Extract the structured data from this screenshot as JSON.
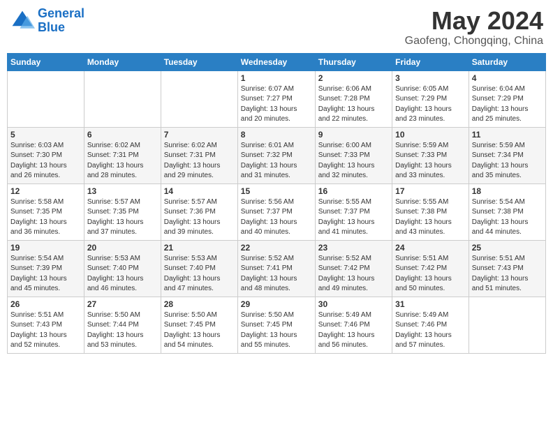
{
  "header": {
    "logo_line1": "General",
    "logo_line2": "Blue",
    "month_year": "May 2024",
    "location": "Gaofeng, Chongqing, China"
  },
  "days_of_week": [
    "Sunday",
    "Monday",
    "Tuesday",
    "Wednesday",
    "Thursday",
    "Friday",
    "Saturday"
  ],
  "weeks": [
    [
      {
        "day": "",
        "info": ""
      },
      {
        "day": "",
        "info": ""
      },
      {
        "day": "",
        "info": ""
      },
      {
        "day": "1",
        "info": "Sunrise: 6:07 AM\nSunset: 7:27 PM\nDaylight: 13 hours\nand 20 minutes."
      },
      {
        "day": "2",
        "info": "Sunrise: 6:06 AM\nSunset: 7:28 PM\nDaylight: 13 hours\nand 22 minutes."
      },
      {
        "day": "3",
        "info": "Sunrise: 6:05 AM\nSunset: 7:29 PM\nDaylight: 13 hours\nand 23 minutes."
      },
      {
        "day": "4",
        "info": "Sunrise: 6:04 AM\nSunset: 7:29 PM\nDaylight: 13 hours\nand 25 minutes."
      }
    ],
    [
      {
        "day": "5",
        "info": "Sunrise: 6:03 AM\nSunset: 7:30 PM\nDaylight: 13 hours\nand 26 minutes."
      },
      {
        "day": "6",
        "info": "Sunrise: 6:02 AM\nSunset: 7:31 PM\nDaylight: 13 hours\nand 28 minutes."
      },
      {
        "day": "7",
        "info": "Sunrise: 6:02 AM\nSunset: 7:31 PM\nDaylight: 13 hours\nand 29 minutes."
      },
      {
        "day": "8",
        "info": "Sunrise: 6:01 AM\nSunset: 7:32 PM\nDaylight: 13 hours\nand 31 minutes."
      },
      {
        "day": "9",
        "info": "Sunrise: 6:00 AM\nSunset: 7:33 PM\nDaylight: 13 hours\nand 32 minutes."
      },
      {
        "day": "10",
        "info": "Sunrise: 5:59 AM\nSunset: 7:33 PM\nDaylight: 13 hours\nand 33 minutes."
      },
      {
        "day": "11",
        "info": "Sunrise: 5:59 AM\nSunset: 7:34 PM\nDaylight: 13 hours\nand 35 minutes."
      }
    ],
    [
      {
        "day": "12",
        "info": "Sunrise: 5:58 AM\nSunset: 7:35 PM\nDaylight: 13 hours\nand 36 minutes."
      },
      {
        "day": "13",
        "info": "Sunrise: 5:57 AM\nSunset: 7:35 PM\nDaylight: 13 hours\nand 37 minutes."
      },
      {
        "day": "14",
        "info": "Sunrise: 5:57 AM\nSunset: 7:36 PM\nDaylight: 13 hours\nand 39 minutes."
      },
      {
        "day": "15",
        "info": "Sunrise: 5:56 AM\nSunset: 7:37 PM\nDaylight: 13 hours\nand 40 minutes."
      },
      {
        "day": "16",
        "info": "Sunrise: 5:55 AM\nSunset: 7:37 PM\nDaylight: 13 hours\nand 41 minutes."
      },
      {
        "day": "17",
        "info": "Sunrise: 5:55 AM\nSunset: 7:38 PM\nDaylight: 13 hours\nand 43 minutes."
      },
      {
        "day": "18",
        "info": "Sunrise: 5:54 AM\nSunset: 7:38 PM\nDaylight: 13 hours\nand 44 minutes."
      }
    ],
    [
      {
        "day": "19",
        "info": "Sunrise: 5:54 AM\nSunset: 7:39 PM\nDaylight: 13 hours\nand 45 minutes."
      },
      {
        "day": "20",
        "info": "Sunrise: 5:53 AM\nSunset: 7:40 PM\nDaylight: 13 hours\nand 46 minutes."
      },
      {
        "day": "21",
        "info": "Sunrise: 5:53 AM\nSunset: 7:40 PM\nDaylight: 13 hours\nand 47 minutes."
      },
      {
        "day": "22",
        "info": "Sunrise: 5:52 AM\nSunset: 7:41 PM\nDaylight: 13 hours\nand 48 minutes."
      },
      {
        "day": "23",
        "info": "Sunrise: 5:52 AM\nSunset: 7:42 PM\nDaylight: 13 hours\nand 49 minutes."
      },
      {
        "day": "24",
        "info": "Sunrise: 5:51 AM\nSunset: 7:42 PM\nDaylight: 13 hours\nand 50 minutes."
      },
      {
        "day": "25",
        "info": "Sunrise: 5:51 AM\nSunset: 7:43 PM\nDaylight: 13 hours\nand 51 minutes."
      }
    ],
    [
      {
        "day": "26",
        "info": "Sunrise: 5:51 AM\nSunset: 7:43 PM\nDaylight: 13 hours\nand 52 minutes."
      },
      {
        "day": "27",
        "info": "Sunrise: 5:50 AM\nSunset: 7:44 PM\nDaylight: 13 hours\nand 53 minutes."
      },
      {
        "day": "28",
        "info": "Sunrise: 5:50 AM\nSunset: 7:45 PM\nDaylight: 13 hours\nand 54 minutes."
      },
      {
        "day": "29",
        "info": "Sunrise: 5:50 AM\nSunset: 7:45 PM\nDaylight: 13 hours\nand 55 minutes."
      },
      {
        "day": "30",
        "info": "Sunrise: 5:49 AM\nSunset: 7:46 PM\nDaylight: 13 hours\nand 56 minutes."
      },
      {
        "day": "31",
        "info": "Sunrise: 5:49 AM\nSunset: 7:46 PM\nDaylight: 13 hours\nand 57 minutes."
      },
      {
        "day": "",
        "info": ""
      }
    ]
  ]
}
